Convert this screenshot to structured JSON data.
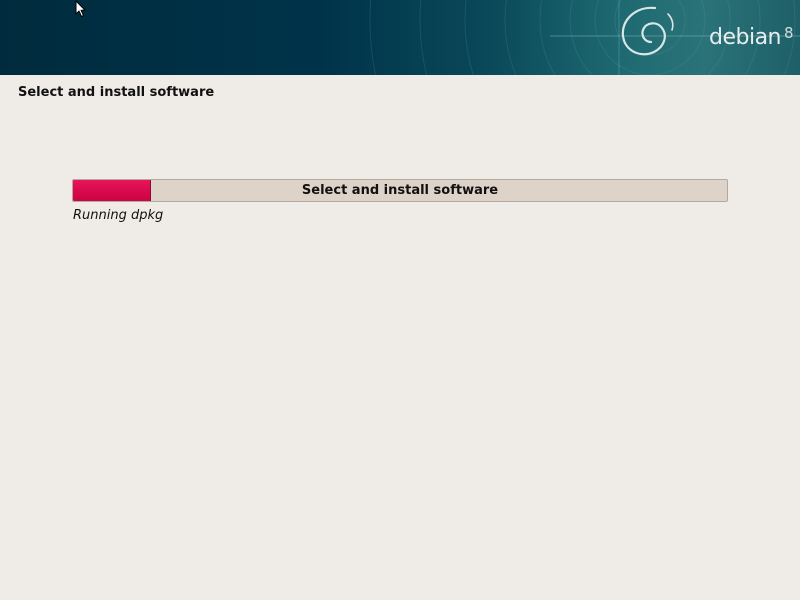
{
  "banner": {
    "logo_text": "debian",
    "logo_version": "8"
  },
  "page": {
    "title": "Select and install software"
  },
  "progress": {
    "label": "Select and install software",
    "fraction": 0.12,
    "status": "Running dpkg",
    "fill_color": "#d7084c"
  },
  "icons": {
    "logo": "debian-swirl-icon",
    "cursor": "mouse-pointer-icon"
  }
}
